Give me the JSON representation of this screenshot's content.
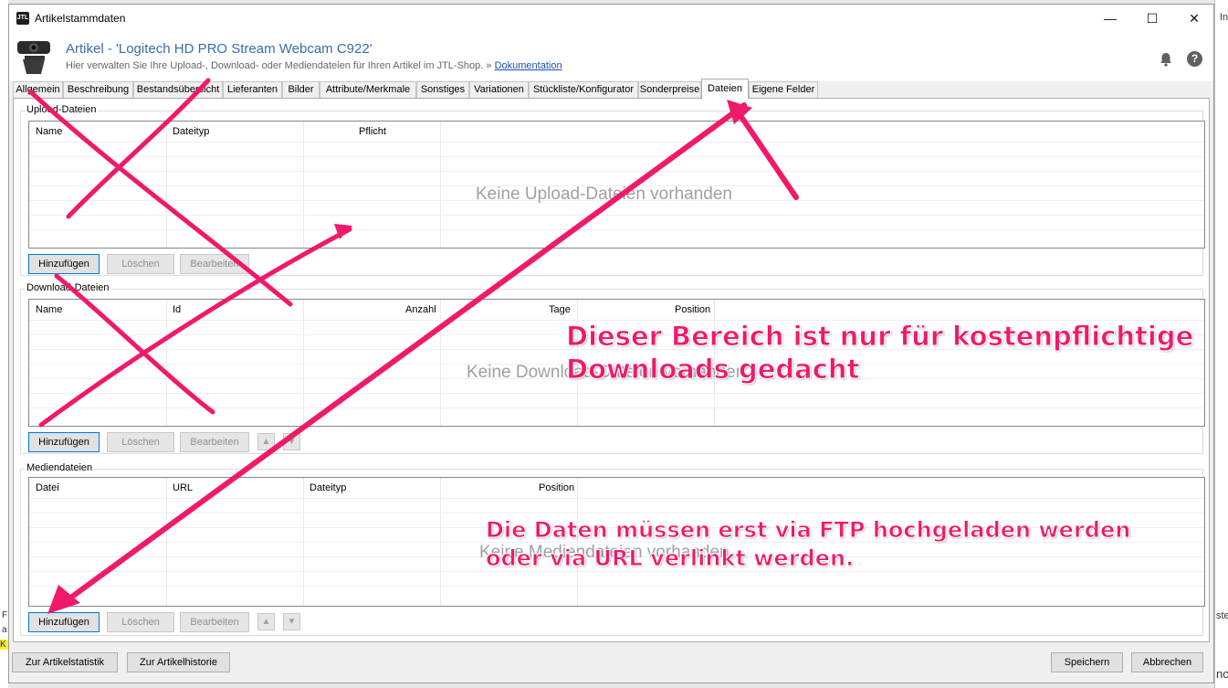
{
  "window": {
    "title": "Artikelstammdaten",
    "logo_text": "JTL"
  },
  "window_controls": {
    "minimize": "—",
    "maximize": "☐",
    "close": "✕"
  },
  "header": {
    "title": "Artikel - 'Logitech HD PRO Stream Webcam C922'",
    "subtitle": "Hier verwalten Sie Ihre Upload-, Download- oder Mediendateien für Ihren Artikel im JTL-Shop.",
    "link_prefix": "»",
    "link_text": "Dokumentation",
    "help_symbol": "?"
  },
  "tabs": [
    {
      "label": "Allgemein"
    },
    {
      "label": "Beschreibung"
    },
    {
      "label": "Bestandsübersicht"
    },
    {
      "label": "Lieferanten"
    },
    {
      "label": "Bilder"
    },
    {
      "label": "Attribute/Merkmale"
    },
    {
      "label": "Sonstiges"
    },
    {
      "label": "Variationen"
    },
    {
      "label": "Stückliste/Konfigurator"
    },
    {
      "label": "Sonderpreise"
    },
    {
      "label": "Dateien"
    },
    {
      "label": "Eigene Felder"
    }
  ],
  "active_tab": "Dateien",
  "upload": {
    "legend": "Upload-Dateien",
    "columns": [
      "Name",
      "Dateityp",
      "Pflicht"
    ],
    "empty_text": "Keine Upload-Dateien vorhanden",
    "buttons": {
      "add": "Hinzufügen",
      "delete": "Löschen",
      "edit": "Bearbeiten"
    }
  },
  "download": {
    "legend": "Download-Dateien",
    "columns": [
      "Name",
      "Id",
      "Anzahl",
      "Tage",
      "Position"
    ],
    "empty_text": "Keine Download-Dateien vorhanden",
    "buttons": {
      "add": "Hinzufügen",
      "delete": "Löschen",
      "edit": "Bearbeiten"
    }
  },
  "media": {
    "legend": "Mediendateien",
    "columns": [
      "Datei",
      "URL",
      "Dateityp",
      "Position"
    ],
    "empty_text": "Keine Mediendateien vorhanden",
    "buttons": {
      "add": "Hinzufügen",
      "delete": "Löschen",
      "edit": "Bearbeiten"
    }
  },
  "footer": {
    "stats_button": "Zur Artikelstatistik",
    "history_button": "Zur Artikelhistorie",
    "save_button": "Speichern",
    "cancel_button": "Abbrechen"
  },
  "annotations": {
    "note1_line1": "Dieser Bereich ist nur für kostenpflichtige",
    "note1_line2": "Downloads gedacht",
    "note2_line1": "Die Daten müssen erst via FTP hochgeladen werden",
    "note2_line2": "oder via URL verlinkt werden."
  },
  "colors": {
    "accent_title": "#3a6ea5",
    "annotation": "#f0196a",
    "link": "#1a4fb3"
  },
  "background_fragments": {
    "right_top": "In",
    "right_mid": "ste",
    "right_bottom": "nc",
    "left_1": "F",
    "left_2": "a",
    "left_3": "K"
  }
}
